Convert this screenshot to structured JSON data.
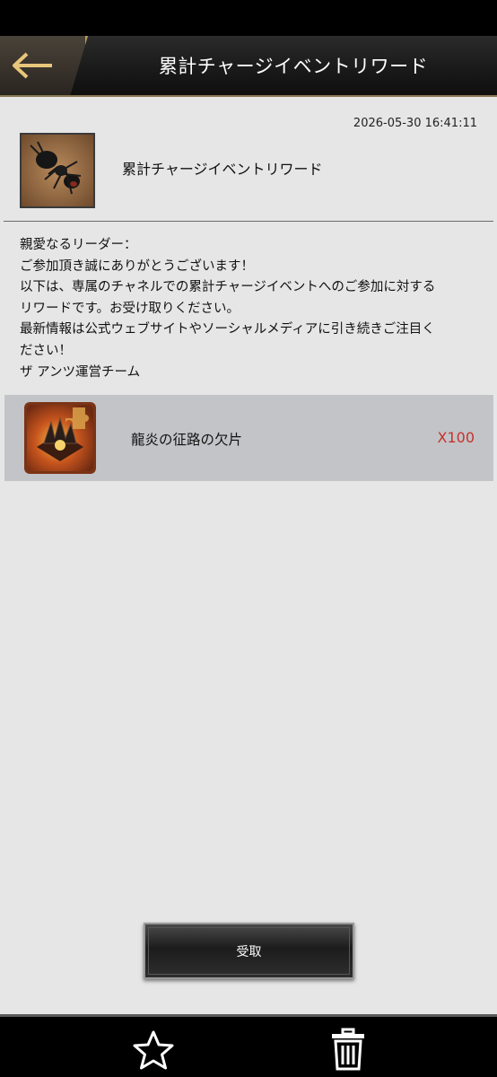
{
  "header": {
    "title": "累計チャージイベントリワード",
    "back_icon": "arrow-left-icon"
  },
  "mail": {
    "timestamp": "2026-05-30 16:41:11",
    "sender_icon": "ant-icon",
    "sender_name": "累計チャージイベントリワード",
    "body_lines": [
      "親愛なるリーダー：",
      "ご参加頂き誠にありがとうございます！",
      "以下は、専属のチャネルでの累計チャージイベントへのご参加に対する",
      "リワードです。お受け取りください。",
      "最新情報は公式ウェブサイトやソーシャルメディアに引き続きご注目く",
      "ださい！",
      "ザ アンツ運営チーム"
    ]
  },
  "reward": {
    "icon": "puzzle-piece-icon",
    "name": "龍炎の征路の欠片",
    "quantity": "X100",
    "quantity_color": "#c7312c"
  },
  "actions": {
    "claim_label": "受取",
    "favorite_icon": "star-icon",
    "delete_icon": "trash-icon"
  }
}
